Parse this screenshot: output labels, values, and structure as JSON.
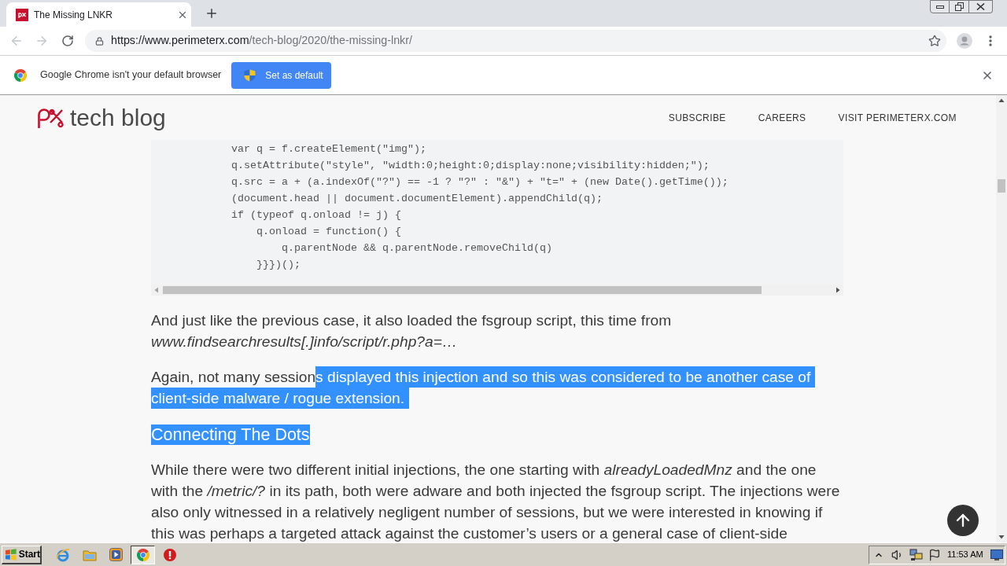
{
  "browser_tab": {
    "title": "The Missing LNKR",
    "selected": true
  },
  "toolbar": {
    "back": {
      "disabled": true
    },
    "forward": {
      "disabled": true
    },
    "url_host": "https://www.perimeterx.com",
    "url_path": "/tech-blog/2020/the-missing-lnkr/"
  },
  "infobar": {
    "message": "Google Chrome isn't your default browser",
    "button": "Set as default"
  },
  "site_header": {
    "logo_text": "tech blog",
    "nav": [
      "SUBSCRIBE",
      "CAREERS",
      "VISIT PERIMETERX.COM"
    ]
  },
  "article": [
    {
      "kind": "code",
      "lines": [
        "var q = f.createElement(\"img\");",
        "q.setAttribute(\"style\", \"width:0;height:0;display:none;visibility:hidden;\");",
        "q.src = a + (a.indexOf(\"?\") == -1 ? \"?\" : \"&\") + \"t=\" + (new Date().getTime());",
        "(document.head || document.documentElement).appendChild(q);",
        "if (typeof q.onload != j) {",
        "    q.onload = function() {",
        "        q.parentNode && q.parentNode.removeChild(q)",
        "    }}})();"
      ]
    },
    {
      "kind": "paragraph",
      "lines": [
        [
          {
            "text": "And just like the previous case, it also loaded the fsgroup script, this time from",
            "selected": false
          }
        ],
        [
          {
            "text": "*www.findsearchresults[.]info/script/r.php?a=…*",
            "selected": false
          }
        ]
      ]
    },
    {
      "kind": "paragraph",
      "lines": [
        [
          {
            "text": "Again, not many session",
            "selected": false
          },
          {
            "text": "s displayed this injection and so this was considered to be another case of",
            "selected": true
          }
        ],
        [
          {
            "text": "client-side malware / rogue extension.",
            "selected": true
          }
        ]
      ]
    },
    {
      "kind": "heading",
      "text": "Connecting The Dots",
      "selected": true
    },
    {
      "kind": "paragraph",
      "lines": [
        [
          {
            "text": "While there were two different initial injections, the one starting with *alreadyLoadedMnz* and the one",
            "selected": false
          }
        ],
        [
          {
            "text": "with the */metric/?* in its path, both were adware and both injected the fsgroup script. The injections were",
            "selected": false
          }
        ],
        [
          {
            "text": "also only witnessed in a relatively negligent number of sessions, but we were interested in knowing if",
            "selected": false
          }
        ],
        [
          {
            "text": "this was perhaps a targeted attack against the customer’s users or a general case of client-side",
            "selected": false
          }
        ]
      ]
    }
  ],
  "taskbar": {
    "start": "Start",
    "apps": [
      {
        "selected": false
      },
      {
        "selected": false
      },
      {
        "selected": false
      },
      {
        "selected": true
      },
      {
        "selected": false
      }
    ],
    "clock": "11:53 AM"
  }
}
